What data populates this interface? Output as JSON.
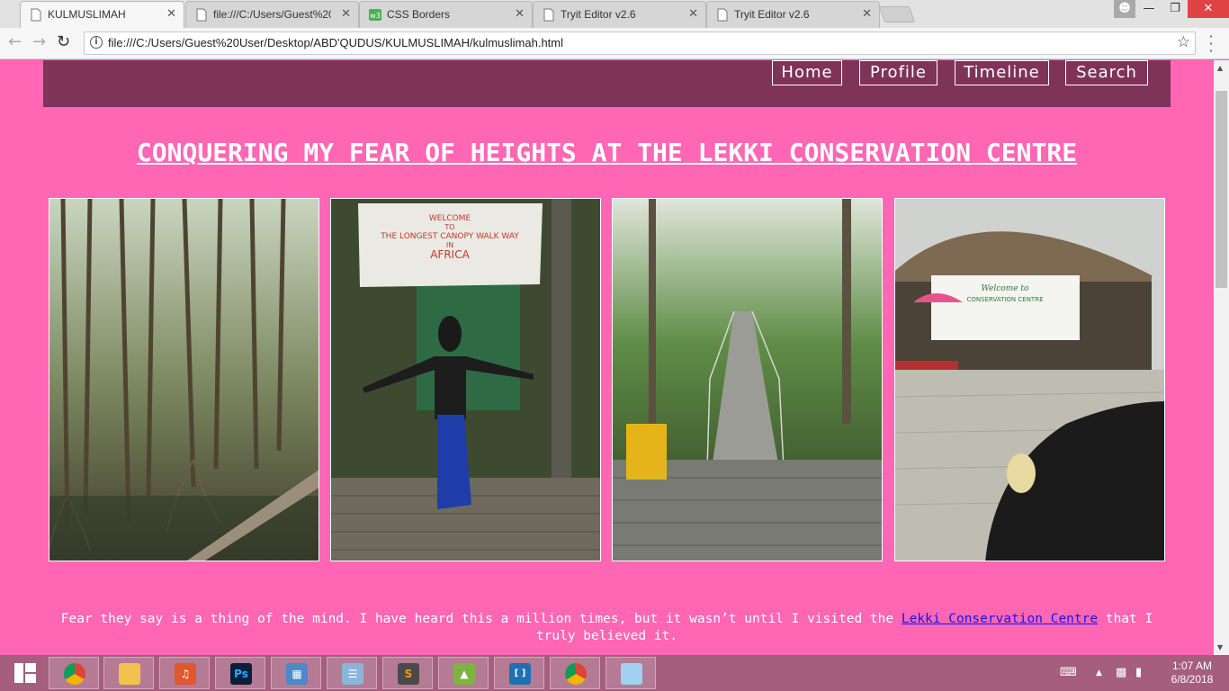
{
  "browser": {
    "tabs": [
      {
        "title": "KULMUSLIMAH",
        "favicon": "page-icon",
        "active": true
      },
      {
        "title": "file:///C:/Users/Guest%20",
        "favicon": "page-icon",
        "active": false
      },
      {
        "title": "CSS Borders",
        "favicon": "w3schools-icon",
        "active": false
      },
      {
        "title": "Tryit Editor v2.6",
        "favicon": "page-icon",
        "active": false
      },
      {
        "title": "Tryit Editor v2.6",
        "favicon": "page-icon",
        "active": false
      }
    ],
    "close_glyph": "✕",
    "window_controls": {
      "minimize": "—",
      "restore": "❐",
      "close": "✕"
    },
    "address_url": "file:///C:/Users/Guest%20User/Desktop/ABD'QUDUS/KULMUSLIMAH/kulmuslimah.html",
    "back_glyph": "←",
    "forward_glyph": "→",
    "reload_glyph": "↻",
    "star_glyph": "☆",
    "info_glyph": "i"
  },
  "page": {
    "nav": [
      "Home",
      "Profile",
      "Timeline",
      "Search"
    ],
    "headline": "CONQUERING MY FEAR OF HEIGHTS AT THE LEKKI CONSERVATION CENTRE",
    "intro_before": "Fear they say is a thing of the mind. I have heard this a million times, but it wasn’t until I visited the ",
    "intro_link": "Lekki Conservation Centre",
    "intro_after": " that I truly believed it.",
    "banner_text": {
      "line1": "WELCOME",
      "line2": "TO",
      "line3": "THE LONGEST CANOPY WALK WAY",
      "line4": "IN",
      "line5": "AFRICA"
    },
    "sign_text": {
      "line1": "Welcome to",
      "line2": "CONSERVATION CENTRE"
    },
    "colors": {
      "background": "#ff66b3",
      "nav_band": "#803358",
      "link": "#1515ee"
    }
  },
  "taskbar": {
    "apps": [
      {
        "name": "chrome-icon",
        "label": ""
      },
      {
        "name": "file-explorer-icon",
        "label": ""
      },
      {
        "name": "audio-app-icon",
        "label": ""
      },
      {
        "name": "photoshop-icon",
        "label": "Ps"
      },
      {
        "name": "calculator-icon",
        "label": ""
      },
      {
        "name": "book-reader-icon",
        "label": ""
      },
      {
        "name": "sublime-text-icon",
        "label": "S"
      },
      {
        "name": "chart-tool-icon",
        "label": ""
      },
      {
        "name": "brackets-icon",
        "label": "[ ]"
      },
      {
        "name": "chrome-icon-2",
        "label": ""
      },
      {
        "name": "notepad-icon",
        "label": ""
      }
    ],
    "time": "1:07 AM",
    "date": "6/8/2018"
  }
}
